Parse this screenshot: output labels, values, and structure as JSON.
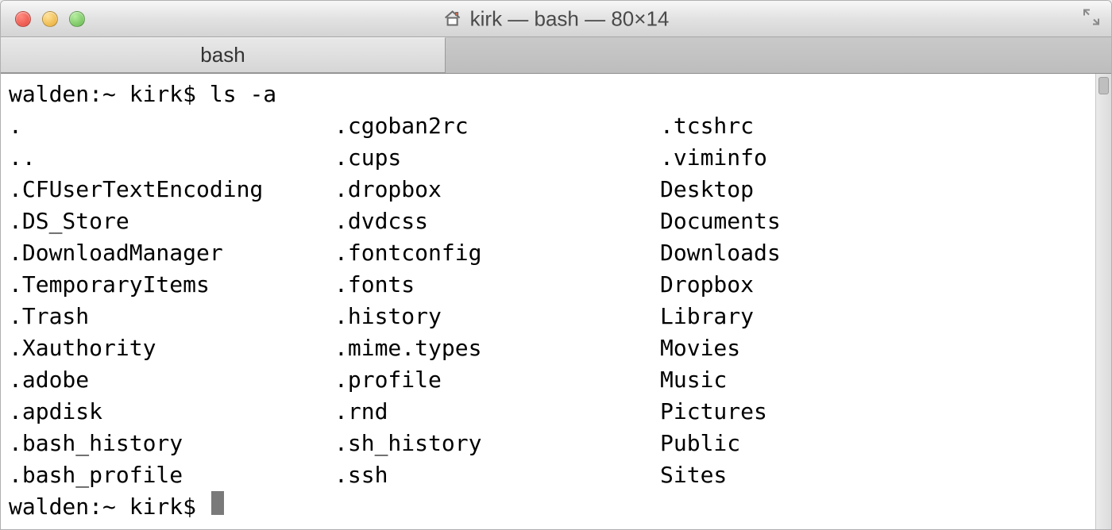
{
  "window": {
    "title": "kirk — bash — 80×14"
  },
  "tabs": [
    {
      "label": "bash"
    }
  ],
  "terminal": {
    "prompt1": "walden:~ kirk$ ",
    "command1": "ls -a",
    "listing": {
      "col0": [
        ".",
        "..",
        ".CFUserTextEncoding",
        ".DS_Store",
        ".DownloadManager",
        ".TemporaryItems",
        ".Trash",
        ".Xauthority",
        ".adobe",
        ".apdisk",
        ".bash_history",
        ".bash_profile"
      ],
      "col1": [
        ".cgoban2rc",
        ".cups",
        ".dropbox",
        ".dvdcss",
        ".fontconfig",
        ".fonts",
        ".history",
        ".mime.types",
        ".profile",
        ".rnd",
        ".sh_history",
        ".ssh"
      ],
      "col2": [
        ".tcshrc",
        ".viminfo",
        "Desktop",
        "Documents",
        "Downloads",
        "Dropbox",
        "Library",
        "Movies",
        "Music",
        "Pictures",
        "Public",
        "Sites"
      ]
    },
    "prompt2": "walden:~ kirk$ "
  }
}
